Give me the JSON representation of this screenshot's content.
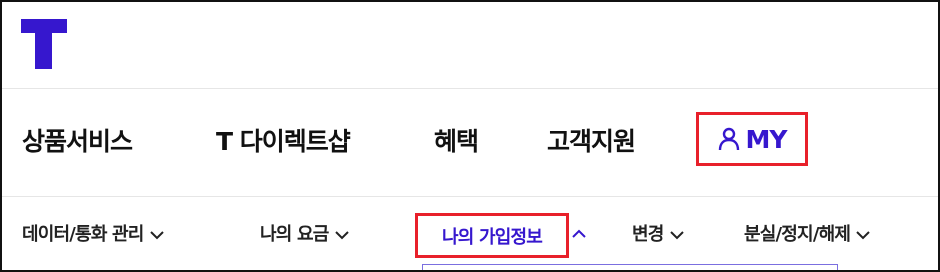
{
  "brand": {
    "logo": "T",
    "color": "#3617ce"
  },
  "gnb": {
    "items": [
      {
        "label": "상품서비스"
      },
      {
        "label": "T 다이렉트샵"
      },
      {
        "label": "혜택"
      },
      {
        "label": "고객지원"
      }
    ],
    "my": {
      "label": "MY",
      "icon": "person-icon"
    }
  },
  "subnav": {
    "items": [
      {
        "label": "데이터/통화 관리"
      },
      {
        "label": "나의 요금"
      },
      {
        "label": "나의 가입정보",
        "active": true
      },
      {
        "label": "변경"
      },
      {
        "label": "분실/정지/해제"
      }
    ]
  },
  "colors": {
    "accent": "#3617ce",
    "highlight": "#e8202a"
  }
}
